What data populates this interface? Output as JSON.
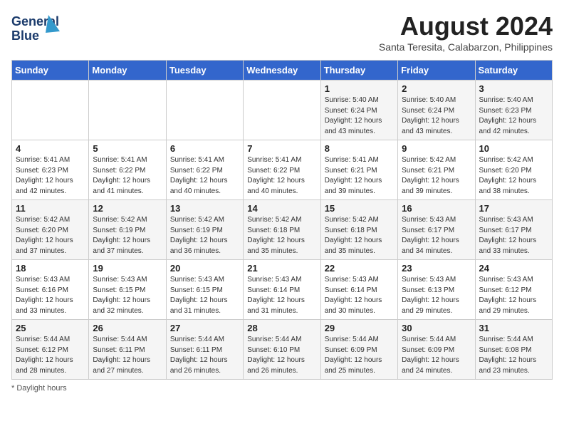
{
  "header": {
    "logo_line1": "General",
    "logo_line2": "Blue",
    "month_year": "August 2024",
    "location": "Santa Teresita, Calabarzon, Philippines"
  },
  "days_of_week": [
    "Sunday",
    "Monday",
    "Tuesday",
    "Wednesday",
    "Thursday",
    "Friday",
    "Saturday"
  ],
  "footer": {
    "note": "Daylight hours"
  },
  "weeks": [
    [
      {
        "day": "",
        "info": ""
      },
      {
        "day": "",
        "info": ""
      },
      {
        "day": "",
        "info": ""
      },
      {
        "day": "",
        "info": ""
      },
      {
        "day": "1",
        "info": "Sunrise: 5:40 AM\nSunset: 6:24 PM\nDaylight: 12 hours\nand 43 minutes."
      },
      {
        "day": "2",
        "info": "Sunrise: 5:40 AM\nSunset: 6:24 PM\nDaylight: 12 hours\nand 43 minutes."
      },
      {
        "day": "3",
        "info": "Sunrise: 5:40 AM\nSunset: 6:23 PM\nDaylight: 12 hours\nand 42 minutes."
      }
    ],
    [
      {
        "day": "4",
        "info": "Sunrise: 5:41 AM\nSunset: 6:23 PM\nDaylight: 12 hours\nand 42 minutes."
      },
      {
        "day": "5",
        "info": "Sunrise: 5:41 AM\nSunset: 6:22 PM\nDaylight: 12 hours\nand 41 minutes."
      },
      {
        "day": "6",
        "info": "Sunrise: 5:41 AM\nSunset: 6:22 PM\nDaylight: 12 hours\nand 40 minutes."
      },
      {
        "day": "7",
        "info": "Sunrise: 5:41 AM\nSunset: 6:22 PM\nDaylight: 12 hours\nand 40 minutes."
      },
      {
        "day": "8",
        "info": "Sunrise: 5:41 AM\nSunset: 6:21 PM\nDaylight: 12 hours\nand 39 minutes."
      },
      {
        "day": "9",
        "info": "Sunrise: 5:42 AM\nSunset: 6:21 PM\nDaylight: 12 hours\nand 39 minutes."
      },
      {
        "day": "10",
        "info": "Sunrise: 5:42 AM\nSunset: 6:20 PM\nDaylight: 12 hours\nand 38 minutes."
      }
    ],
    [
      {
        "day": "11",
        "info": "Sunrise: 5:42 AM\nSunset: 6:20 PM\nDaylight: 12 hours\nand 37 minutes."
      },
      {
        "day": "12",
        "info": "Sunrise: 5:42 AM\nSunset: 6:19 PM\nDaylight: 12 hours\nand 37 minutes."
      },
      {
        "day": "13",
        "info": "Sunrise: 5:42 AM\nSunset: 6:19 PM\nDaylight: 12 hours\nand 36 minutes."
      },
      {
        "day": "14",
        "info": "Sunrise: 5:42 AM\nSunset: 6:18 PM\nDaylight: 12 hours\nand 35 minutes."
      },
      {
        "day": "15",
        "info": "Sunrise: 5:42 AM\nSunset: 6:18 PM\nDaylight: 12 hours\nand 35 minutes."
      },
      {
        "day": "16",
        "info": "Sunrise: 5:43 AM\nSunset: 6:17 PM\nDaylight: 12 hours\nand 34 minutes."
      },
      {
        "day": "17",
        "info": "Sunrise: 5:43 AM\nSunset: 6:17 PM\nDaylight: 12 hours\nand 33 minutes."
      }
    ],
    [
      {
        "day": "18",
        "info": "Sunrise: 5:43 AM\nSunset: 6:16 PM\nDaylight: 12 hours\nand 33 minutes."
      },
      {
        "day": "19",
        "info": "Sunrise: 5:43 AM\nSunset: 6:15 PM\nDaylight: 12 hours\nand 32 minutes."
      },
      {
        "day": "20",
        "info": "Sunrise: 5:43 AM\nSunset: 6:15 PM\nDaylight: 12 hours\nand 31 minutes."
      },
      {
        "day": "21",
        "info": "Sunrise: 5:43 AM\nSunset: 6:14 PM\nDaylight: 12 hours\nand 31 minutes."
      },
      {
        "day": "22",
        "info": "Sunrise: 5:43 AM\nSunset: 6:14 PM\nDaylight: 12 hours\nand 30 minutes."
      },
      {
        "day": "23",
        "info": "Sunrise: 5:43 AM\nSunset: 6:13 PM\nDaylight: 12 hours\nand 29 minutes."
      },
      {
        "day": "24",
        "info": "Sunrise: 5:43 AM\nSunset: 6:12 PM\nDaylight: 12 hours\nand 29 minutes."
      }
    ],
    [
      {
        "day": "25",
        "info": "Sunrise: 5:44 AM\nSunset: 6:12 PM\nDaylight: 12 hours\nand 28 minutes."
      },
      {
        "day": "26",
        "info": "Sunrise: 5:44 AM\nSunset: 6:11 PM\nDaylight: 12 hours\nand 27 minutes."
      },
      {
        "day": "27",
        "info": "Sunrise: 5:44 AM\nSunset: 6:11 PM\nDaylight: 12 hours\nand 26 minutes."
      },
      {
        "day": "28",
        "info": "Sunrise: 5:44 AM\nSunset: 6:10 PM\nDaylight: 12 hours\nand 26 minutes."
      },
      {
        "day": "29",
        "info": "Sunrise: 5:44 AM\nSunset: 6:09 PM\nDaylight: 12 hours\nand 25 minutes."
      },
      {
        "day": "30",
        "info": "Sunrise: 5:44 AM\nSunset: 6:09 PM\nDaylight: 12 hours\nand 24 minutes."
      },
      {
        "day": "31",
        "info": "Sunrise: 5:44 AM\nSunset: 6:08 PM\nDaylight: 12 hours\nand 23 minutes."
      }
    ]
  ]
}
